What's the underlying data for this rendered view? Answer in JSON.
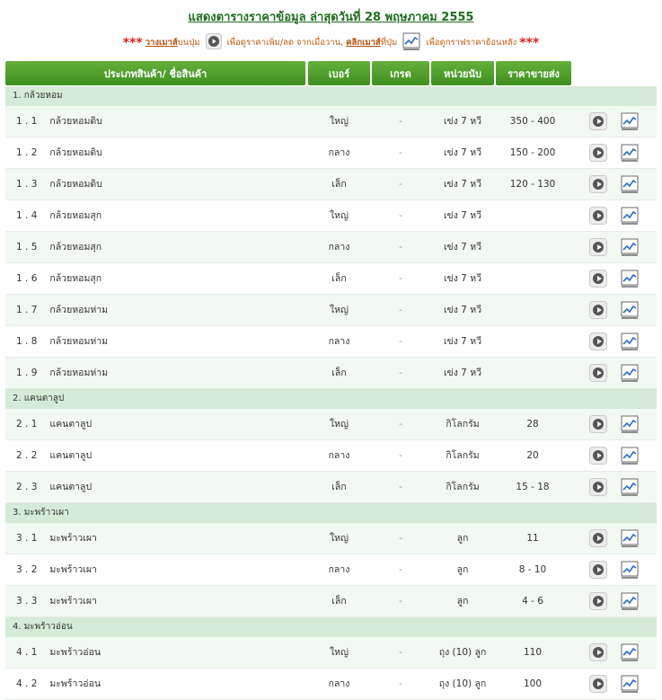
{
  "title": "แสดงตารางราคาข้อมูล ล่าสุดวันที่ 28 พฤษภาคม 2555",
  "hint": {
    "stars": "***",
    "hover_link": "วางเมาส์",
    "text1": "บนปุ่ม",
    "text2": "เพื่อดูราคาเพิ่ม/ลด จากเมื่อวาน,",
    "click_link": "คลิกเมาส์",
    "text3": "ที่ปุ่ม",
    "text4": "เพื่อดูกราฟราคาย้อนหลัง"
  },
  "header": {
    "product": "ประเภทสินค้า/ ชื่อสินค้า",
    "size": "เบอร์",
    "grade": "เกรด",
    "unit": "หน่วยนับ",
    "price": "ราคาขายส่ง"
  },
  "categories": [
    {
      "name": "1. กล้วยหอม",
      "items": [
        {
          "no": "1 . 1",
          "name": "กล้วยหอมดิบ",
          "size": "ใหญ่",
          "grade": "-",
          "unit": "เข่ง 7 หวี",
          "price": "350 - 400"
        },
        {
          "no": "1 . 2",
          "name": "กล้วยหอมดิบ",
          "size": "กลาง",
          "grade": "-",
          "unit": "เข่ง 7 หวี",
          "price": "150 - 200"
        },
        {
          "no": "1 . 3",
          "name": "กล้วยหอมดิบ",
          "size": "เล็ก",
          "grade": "-",
          "unit": "เข่ง 7 หวี",
          "price": "120 - 130"
        },
        {
          "no": "1 . 4",
          "name": "กล้วยหอมสุก",
          "size": "ใหญ่",
          "grade": "-",
          "unit": "เข่ง 7 หวี",
          "price": ""
        },
        {
          "no": "1 . 5",
          "name": "กล้วยหอมสุก",
          "size": "กลาง",
          "grade": "-",
          "unit": "เข่ง 7 หวี",
          "price": ""
        },
        {
          "no": "1 . 6",
          "name": "กล้วยหอมสุก",
          "size": "เล็ก",
          "grade": "-",
          "unit": "เข่ง 7 หวี",
          "price": ""
        },
        {
          "no": "1 . 7",
          "name": "กล้วยหอมห่าม",
          "size": "ใหญ่",
          "grade": "-",
          "unit": "เข่ง 7 หวี",
          "price": ""
        },
        {
          "no": "1 . 8",
          "name": "กล้วยหอมห่าม",
          "size": "กลาง",
          "grade": "-",
          "unit": "เข่ง 7 หวี",
          "price": ""
        },
        {
          "no": "1 . 9",
          "name": "กล้วยหอมห่าม",
          "size": "เล็ก",
          "grade": "-",
          "unit": "เข่ง 7 หวี",
          "price": ""
        }
      ]
    },
    {
      "name": "2. แคนตาลูป",
      "items": [
        {
          "no": "2 . 1",
          "name": "แคนตาลูป",
          "size": "ใหญ่",
          "grade": "-",
          "unit": "กิโลกรัม",
          "price": "28"
        },
        {
          "no": "2 . 2",
          "name": "แคนตาลูป",
          "size": "กลาง",
          "grade": "-",
          "unit": "กิโลกรัม",
          "price": "20"
        },
        {
          "no": "2 . 3",
          "name": "แคนตาลูป",
          "size": "เล็ก",
          "grade": "-",
          "unit": "กิโลกรัม",
          "price": "15 - 18"
        }
      ]
    },
    {
      "name": "3. มะพร้าวเผา",
      "items": [
        {
          "no": "3 . 1",
          "name": "มะพร้าวเผา",
          "size": "ใหญ่",
          "grade": "-",
          "unit": "ลูก",
          "price": "11"
        },
        {
          "no": "3 . 2",
          "name": "มะพร้าวเผา",
          "size": "กลาง",
          "grade": "-",
          "unit": "ลูก",
          "price": "8 - 10"
        },
        {
          "no": "3 . 3",
          "name": "มะพร้าวเผา",
          "size": "เล็ก",
          "grade": "-",
          "unit": "ลูก",
          "price": "4 - 6"
        }
      ]
    },
    {
      "name": "4. มะพร้าวอ่อน",
      "items": [
        {
          "no": "4 . 1",
          "name": "มะพร้าวอ่อน",
          "size": "ใหญ่",
          "grade": "-",
          "unit": "ถุง (10) ลูก",
          "price": "110"
        },
        {
          "no": "4 . 2",
          "name": "มะพร้าวอ่อน",
          "size": "กลาง",
          "grade": "-",
          "unit": "ถุง (10) ลูก",
          "price": "100"
        }
      ]
    }
  ]
}
